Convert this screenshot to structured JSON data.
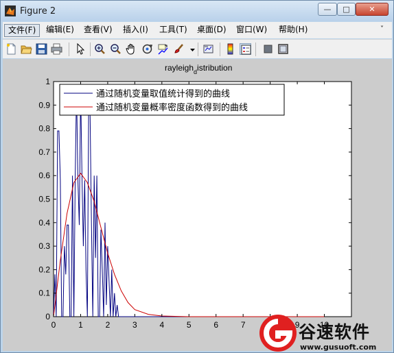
{
  "window": {
    "title": "Figure 2",
    "controls": {
      "minimize": "—",
      "maximize": "□",
      "close": "✕"
    }
  },
  "menubar": {
    "items": [
      {
        "label": "文件(F)",
        "active": true
      },
      {
        "label": "编辑(E)"
      },
      {
        "label": "查看(V)"
      },
      {
        "label": "插入(I)"
      },
      {
        "label": "工具(T)"
      },
      {
        "label": "桌面(D)"
      },
      {
        "label": "窗口(W)"
      },
      {
        "label": "帮助(H)"
      }
    ],
    "overflow": "˅"
  },
  "toolbar": {
    "icons": [
      "new-figure-icon",
      "open-file-icon",
      "save-icon",
      "print-icon",
      "pointer-icon",
      "zoom-in-icon",
      "zoom-out-icon",
      "pan-hand-icon",
      "rotate-3d-icon",
      "data-cursor-icon",
      "brush-icon",
      "dropdown-arrow-icon",
      "link-plot-icon",
      "colorbar-icon",
      "legend-icon",
      "hide-plot-tools-icon",
      "show-plot-tools-icon"
    ]
  },
  "chart_data": {
    "type": "line",
    "title_main": "rayleigh",
    "title_sub": "d",
    "title_rest": "istribution",
    "xlim": [
      0,
      11
    ],
    "ylim": [
      0,
      1
    ],
    "xticks": [
      "0",
      "1",
      "2",
      "3",
      "4",
      "5",
      "6",
      "7",
      "8",
      "9",
      "10"
    ],
    "yticks": [
      "0",
      "0.1",
      "0.2",
      "0.3",
      "0.4",
      "0.5",
      "0.6",
      "0.7",
      "0.8",
      "0.9",
      "1"
    ],
    "grid": false,
    "legend_position": "top-left",
    "series": [
      {
        "name": "通过随机变量取值统计得到的曲线",
        "color": "#00007f",
        "x": [
          0,
          0.05,
          0.1,
          0.15,
          0.2,
          0.25,
          0.3,
          0.35,
          0.4,
          0.45,
          0.5,
          0.55,
          0.6,
          0.65,
          0.7,
          0.75,
          0.8,
          0.85,
          0.9,
          0.95,
          1.0,
          1.05,
          1.1,
          1.15,
          1.2,
          1.25,
          1.3,
          1.35,
          1.4,
          1.45,
          1.5,
          1.55,
          1.6,
          1.65,
          1.7,
          1.75,
          1.8,
          1.85,
          1.9,
          1.95,
          2.0,
          2.05,
          2.1,
          2.15,
          2.2,
          2.25,
          2.3,
          2.35,
          2.4,
          2.45,
          2.5,
          3.0,
          4.0,
          5.0,
          6.0,
          7.0,
          8.0,
          9.0,
          10.0
        ],
        "values": [
          0,
          0.18,
          0.0,
          0.79,
          0.79,
          0.58,
          0.0,
          0.0,
          0.3,
          0.18,
          0.39,
          0.39,
          0.0,
          0.0,
          0.6,
          0.0,
          0.6,
          0.97,
          0.58,
          0.39,
          0.97,
          0.6,
          0.3,
          0.58,
          0.2,
          0.0,
          0.97,
          0.85,
          0.4,
          0.0,
          0.6,
          0.25,
          0.6,
          0.0,
          0.0,
          0.37,
          0.2,
          0.0,
          0.4,
          0.05,
          0.3,
          0.15,
          0.0,
          0.2,
          0.0,
          0.1,
          0.0,
          0.05,
          0.0,
          0.0,
          0,
          0,
          0,
          0,
          0,
          0,
          0,
          0,
          0
        ]
      },
      {
        "name": "通过随机变量概率密度函数得到的曲线",
        "color": "#cc0000",
        "x": [
          0,
          0.25,
          0.5,
          0.75,
          1.0,
          1.25,
          1.5,
          1.75,
          2.0,
          2.25,
          2.5,
          2.75,
          3.0,
          3.5,
          4.0,
          5.0,
          6.0,
          7.0,
          8.0,
          9.0,
          10.0
        ],
        "values": [
          0,
          0.24,
          0.44,
          0.57,
          0.61,
          0.57,
          0.49,
          0.38,
          0.27,
          0.18,
          0.11,
          0.06,
          0.03,
          0.01,
          0.003,
          0,
          0,
          0,
          0,
          0,
          0
        ]
      }
    ]
  },
  "watermark": {
    "text": "谷速软件",
    "url": "www.gusuoft.com"
  }
}
